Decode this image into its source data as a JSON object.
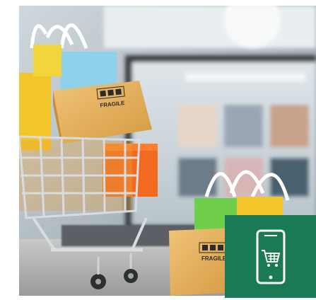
{
  "photo": {
    "box_labels": [
      "FRAGILE",
      "FRAGILE"
    ],
    "colors": {
      "cardboard": "#e8b25a",
      "bag_yellow": "#f2c62a",
      "bag_orange": "#f26a1f",
      "bag_blue": "#8fd0ea",
      "bag_green": "#6fce4a",
      "cart_metal": "#cfd3d6"
    }
  },
  "badge": {
    "background": "#1b7a56",
    "icon": "smartphone-shopping-cart-icon"
  }
}
